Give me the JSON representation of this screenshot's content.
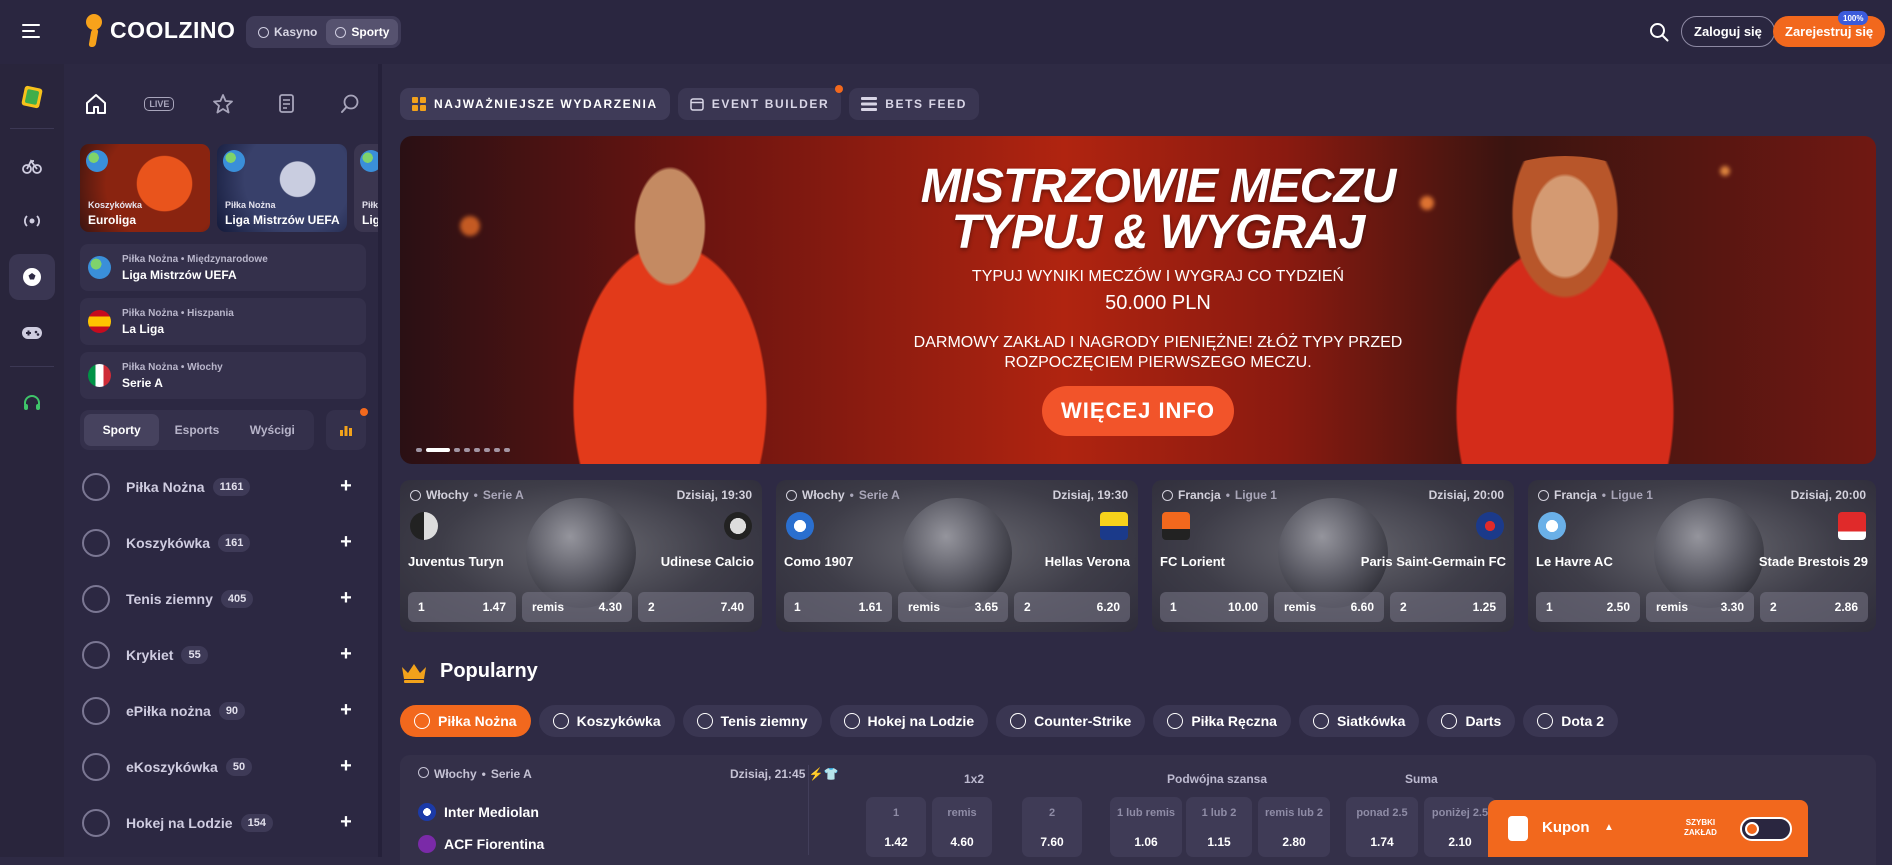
{
  "header": {
    "logo_text": "COOLZINO",
    "mode_casino": "Kasyno",
    "mode_sports": "Sporty",
    "login_label": "Zaloguj się",
    "register_label": "Zarejestruj się",
    "register_badge": "100%"
  },
  "rail": {
    "icons": [
      "promo-card-icon",
      "football-bicycle-icon",
      "live-signal-icon",
      "soccer-ball-icon",
      "gamepad-icon",
      "headset-icon"
    ]
  },
  "sidebar": {
    "tabs": [
      "home-icon",
      "live-icon",
      "star-icon",
      "betslip-icon",
      "search-icon"
    ],
    "live_label": "LIVE",
    "tiles": [
      {
        "sub": "Koszykówka",
        "title": "Euroliga"
      },
      {
        "sub": "Piłka Nożna",
        "title": "Liga Mistrzów UEFA"
      },
      {
        "sub": "Piłka",
        "title": "Liga"
      }
    ],
    "leagues": [
      {
        "sub": "Piłka Nożna • Międzynarodowe",
        "name": "Liga Mistrzów UEFA"
      },
      {
        "sub": "Piłka Nożna • Hiszpania",
        "name": "La Liga"
      },
      {
        "sub": "Piłka Nożna • Włochy",
        "name": "Serie A"
      }
    ],
    "segments": [
      "Sporty",
      "Esports",
      "Wyścigi"
    ],
    "sports": [
      {
        "name": "Piłka Nożna",
        "count": "1161"
      },
      {
        "name": "Koszykówka",
        "count": "161"
      },
      {
        "name": "Tenis ziemny",
        "count": "405"
      },
      {
        "name": "Krykiet",
        "count": "55"
      },
      {
        "name": "ePiłka nożna",
        "count": "90"
      },
      {
        "name": "eKoszykówka",
        "count": "50"
      },
      {
        "name": "Hokej na Lodzie",
        "count": "154"
      }
    ]
  },
  "main": {
    "tabs": [
      "NAJWAŻNIEJSZE WYDARZENIA",
      "EVENT BUILDER",
      "BETS FEED"
    ],
    "banner": {
      "title1": "MISTRZOWIE MECZU",
      "title2": "TYPUJ & WYGRAJ",
      "line1": "TYPUJ WYNIKI MECZÓW I WYGRAJ CO TYDZIEŃ",
      "amount": "50.000 PLN",
      "line2": "DARMOWY ZAKŁAD I NAGRODY PIENIĘŻNE! ZŁÓŻ TYPY PRZED",
      "line3": "ROZPOCZĘCIEM PIERWSZEGO MECZU.",
      "button": "WIĘCEJ INFO"
    },
    "matches": [
      {
        "country": "Włochy",
        "league": "Serie A",
        "time": "Dzisiaj, 19:30",
        "home": "Juventus Turyn",
        "away": "Udinese Calcio",
        "o1l": "1",
        "o1": "1.47",
        "oxl": "remis",
        "ox": "4.30",
        "o2l": "2",
        "o2": "7.40"
      },
      {
        "country": "Włochy",
        "league": "Serie A",
        "time": "Dzisiaj, 19:30",
        "home": "Como 1907",
        "away": "Hellas Verona",
        "o1l": "1",
        "o1": "1.61",
        "oxl": "remis",
        "ox": "3.65",
        "o2l": "2",
        "o2": "6.20"
      },
      {
        "country": "Francja",
        "league": "Ligue 1",
        "time": "Dzisiaj, 20:00",
        "home": "FC Lorient",
        "away": "Paris Saint-Germain FC",
        "o1l": "1",
        "o1": "10.00",
        "oxl": "remis",
        "ox": "6.60",
        "o2l": "2",
        "o2": "1.25"
      },
      {
        "country": "Francja",
        "league": "Ligue 1",
        "time": "Dzisiaj, 20:00",
        "home": "Le Havre AC",
        "away": "Stade Brestois 29",
        "o1l": "1",
        "o1": "2.50",
        "oxl": "remis",
        "ox": "3.30",
        "o2l": "2",
        "o2": "2.86"
      }
    ],
    "popular_title": "Popularny",
    "chips": [
      "Piłka Nożna",
      "Koszykówka",
      "Tenis ziemny",
      "Hokej na Lodzie",
      "Counter-Strike",
      "Piłka Ręczna",
      "Siatkówka",
      "Darts",
      "Dota 2"
    ],
    "event": {
      "country": "Włochy",
      "league": "Serie A",
      "time": "Dzisiaj, 21:45",
      "home": "Inter Mediolan",
      "away": "ACF Fiorentina",
      "markets": [
        "1x2",
        "Podwójna szansa",
        "Suma"
      ],
      "odds": [
        {
          "label": "1",
          "value": "1.42"
        },
        {
          "label": "remis",
          "value": "4.60"
        },
        {
          "label": "2",
          "value": "7.60"
        },
        {
          "label": "1 lub remis",
          "value": "1.06"
        },
        {
          "label": "1 lub 2",
          "value": "1.15"
        },
        {
          "label": "remis lub 2",
          "value": "2.80"
        },
        {
          "label": "ponad 2.5",
          "value": "1.74"
        },
        {
          "label": "poniżej 2.5",
          "value": "2.10"
        }
      ]
    }
  },
  "coupon": {
    "label": "Kupon",
    "fast_bet_line1": "SZYBKI",
    "fast_bet_line2": "ZAKŁAD"
  },
  "colors": {
    "accent": "#f2681d",
    "bg": "#2e2a44",
    "panel": "#34304b"
  }
}
